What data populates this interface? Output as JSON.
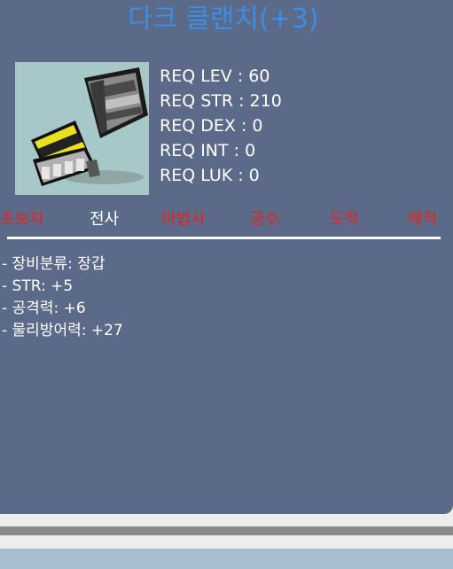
{
  "item": {
    "name": "다크 클랜치(+3)",
    "image_icon": "dark-gauntlet-icon"
  },
  "requirements": [
    {
      "label": "REQ LEV : 60"
    },
    {
      "label": "REQ STR : 210"
    },
    {
      "label": "REQ DEX : 0"
    },
    {
      "label": "REQ INT : 0"
    },
    {
      "label": "REQ LUK : 0"
    }
  ],
  "jobs": [
    {
      "label": "초보자",
      "available": false
    },
    {
      "label": "전사",
      "available": true
    },
    {
      "label": "마법사",
      "available": false
    },
    {
      "label": "궁수",
      "available": false
    },
    {
      "label": "도적",
      "available": false
    },
    {
      "label": "해적",
      "available": false
    }
  ],
  "stats": [
    {
      "text": "- 장비분류: 장갑"
    },
    {
      "text": "- STR: +5"
    },
    {
      "text": "- 공격력: +6"
    },
    {
      "text": "- 물리방어력: +27"
    }
  ],
  "colors": {
    "panel": "#5b6a88",
    "title": "#3b8de8",
    "job_unavailable": "#e5241f",
    "job_available": "#ffffff"
  }
}
